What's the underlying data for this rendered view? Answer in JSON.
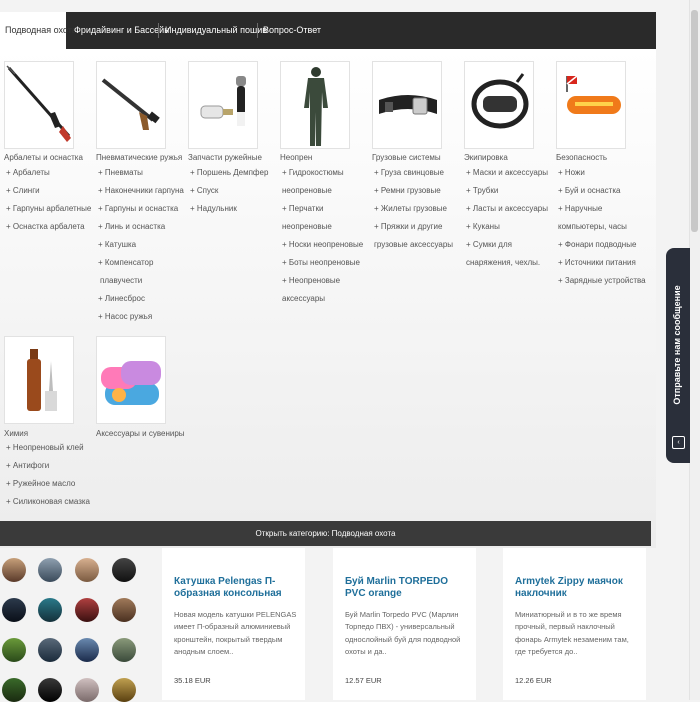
{
  "nav": {
    "tabs": [
      {
        "label": "Подводная охота"
      },
      {
        "label": "Фридайвинг и Бассейн"
      },
      {
        "label": "Индивидуальный пошив"
      },
      {
        "label": "Вопрос-Ответ"
      }
    ]
  },
  "menu": {
    "categories": [
      {
        "title": "Арбалеты и оснастка",
        "image_icon": "speargun-icon",
        "subs": [
          "+ Арбалеты",
          "+ Слинги",
          "+ Гарпуны арбалетные",
          "+ Оснастка арбалета"
        ]
      },
      {
        "title": "Пневматические ружья",
        "image_icon": "pneumatic-gun-icon",
        "subs": [
          "+ Пневматы",
          "+ Наконечники гарпуна",
          "+ Гарпуны и оснастка",
          "+ Линь и оснастка",
          "+ Катушка",
          "+ Компенсатор",
          "плавучести",
          "+ Линесброс",
          "+ Насос ружья"
        ]
      },
      {
        "title": "Запчасти ружейные",
        "image_icon": "gun-parts-icon",
        "subs": [
          "+ Поршень Демпфер",
          "+ Спуск",
          "+ Надульник"
        ]
      },
      {
        "title": "Неопрен",
        "image_icon": "wetsuit-icon",
        "subs": [
          "+ Гидрокостюмы",
          "неопреновые",
          "+ Перчатки",
          "неопреновые",
          "+ Носки неопреновые",
          "+ Боты неопреновые",
          "+ Неопреновые",
          "аксессуары"
        ]
      },
      {
        "title": "Грузовые системы",
        "image_icon": "weight-belt-icon",
        "subs": [
          "+ Груза свинцовые",
          "+ Ремни грузовые",
          "+ Жилеты грузовые",
          "+ Пряжки и другие",
          "грузовые аксессуары"
        ]
      },
      {
        "title": "Экипировка",
        "image_icon": "mask-icon",
        "subs": [
          "+ Маски и аксессуары",
          "+ Трубки",
          "+ Ласты и аксессуары",
          "+ Куканы",
          "+ Сумки для",
          "снаряжения, чехлы."
        ]
      },
      {
        "title": "Безопасность",
        "image_icon": "buoy-icon",
        "subs": [
          "+ Ножи",
          "+ Буй и оснастка",
          "+ Наручные",
          "компьютеры, часы",
          "+ Фонари подводные",
          "+ Источники питания",
          "+ Зарядные устройства"
        ]
      },
      {
        "title": "Химия",
        "image_icon": "glue-bottle-icon",
        "subs": [
          "+ Неопреновый клей",
          "+ Антифоги",
          "+ Ружейное масло",
          "+ Силиконовая смазка"
        ]
      },
      {
        "title": "Аксессуары и сувениры",
        "image_icon": "towels-icon",
        "subs": []
      }
    ],
    "open_category_label": "Открыть категорию: Подводная охота"
  },
  "products": [
    {
      "title": "Катушка Pelengas П-образная консольная",
      "desc": "Новая модель катушки PELENGAS имеет П-образный алюминиевый кронштейн, покрытый твердым анодным слоем..",
      "price": "35.18 EUR"
    },
    {
      "title": "Буй Marlin TORPEDO PVC orange",
      "desc": "Буй Marlin Torpedo PVC (Марлин Торпедо ПВХ) - универсальный однослойный буй для подводной охоты и да..",
      "price": "12.57 EUR"
    },
    {
      "title": "Armytek Zippy маячок наклочник",
      "desc": "Миниатюрный и в то же время прочный, первый наклочный фонарь Armytek незаменим там, где требуется до..",
      "price": "12.26 EUR"
    }
  ],
  "feedback": {
    "label": "Отправьте нам сообщение",
    "icon": "chat-icon"
  },
  "colors": {
    "nav_bg": "#2a2a2a",
    "product_title": "#1f6f9a",
    "feedback_bg": "#2a2f3a"
  }
}
